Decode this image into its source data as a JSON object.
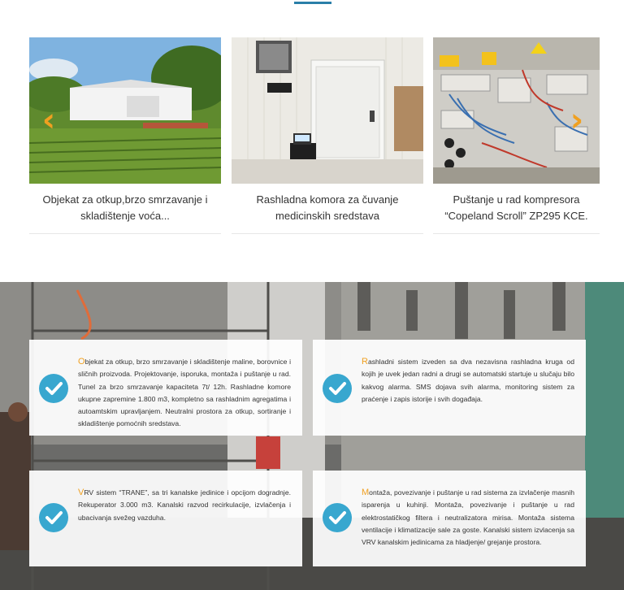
{
  "carousel": {
    "items": [
      {
        "caption": "Objekat za otkup,brzo smrzavanje i skladištenje voća...",
        "image": "warehouse-building-photo"
      },
      {
        "caption": "Rashladna komora za čuvanje medicinskih sredstava",
        "image": "cold-room-door-photo"
      },
      {
        "caption": "Puštanje u rad kompresora “Copeland Scroll” ZP295 KCE.",
        "image": "electrical-panel-photo"
      }
    ],
    "prev_icon": "chevron-left-icon",
    "next_icon": "chevron-right-icon",
    "arrow_color": "#f0a020"
  },
  "features": {
    "accent_color": "#38a7cf",
    "items": [
      {
        "first_letter": "O",
        "rest": "bjekat za otkup, brzo smrzavanje i skladištenje maline, borovnice i sličnih proizvoda. Projektovanje, isporuka, montaža i puštanje u rad. Tunel za brzo smrzavanje kapaciteta 7t/ 12h. Rashladne komore ukupne zapremine 1.800 m3, kompletno sa rashladnim agregatima i autoamtskim upravljanjem. Neutralni prostora za otkup, sortiranje i skladištenje pomoćnih sredstava."
      },
      {
        "first_letter": "R",
        "rest": "ashladni sistem izveden sa dva nezavisna rashladna kruga od kojih je uvek jedan radni a drugi se automatski startuje u slučaju bilo kakvog alarma. SMS dojava svih alarma, monitoring sistem za praćenje i zapis istorije i svih događaja."
      },
      {
        "first_letter": "V",
        "rest": "RV sistem “TRANE”, sa tri kanalske jedinice i opcijom dogradnje. Rekuperator 3.000 m3. Kanalski razvod recirkulacije, izvlačenja i ubacivanja svežeg vazduha."
      },
      {
        "first_letter": "M",
        "rest": "ontaža, povezivanje i puštanje u rad sistema za izvlačenje masnih isparenja u kuhinji. Montaža, povezivanje i puštanje u rad elektrostatičkog filtera i neutralizatora mirisa. Montaža sistema ventilacije i klimatizacije sale za goste. Kanalski sistem izvlacenja sa VRV kanalskim jedinicama za hladjenje/ grejanje prostora."
      }
    ]
  }
}
